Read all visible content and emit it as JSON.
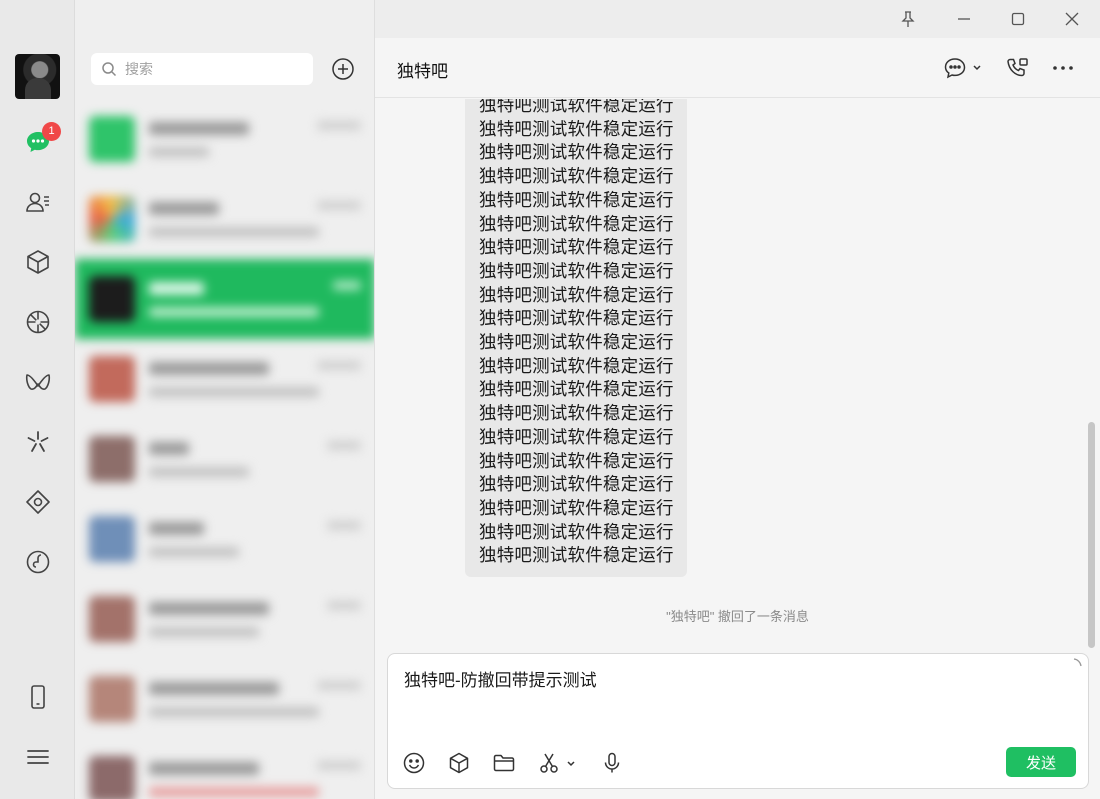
{
  "rail": {
    "unread_badge": "1",
    "icons": [
      "chat-icon",
      "contacts-icon",
      "cube-icon",
      "moments-icon",
      "channels-icon",
      "discover-icon",
      "mini-program-icon",
      "music-icon",
      "phone-icon",
      "menu-icon"
    ]
  },
  "search": {
    "placeholder": "搜索"
  },
  "chat": {
    "title": "独特吧",
    "bubble_lines": [
      "独特吧测试软件稳定运行",
      "独特吧测试软件稳定运行",
      "独特吧测试软件稳定运行",
      "独特吧测试软件稳定运行",
      "独特吧测试软件稳定运行",
      "独特吧测试软件稳定运行",
      "独特吧测试软件稳定运行",
      "独特吧测试软件稳定运行",
      "独特吧测试软件稳定运行",
      "独特吧测试软件稳定运行",
      "独特吧测试软件稳定运行",
      "独特吧测试软件稳定运行",
      "独特吧测试软件稳定运行",
      "独特吧测试软件稳定运行",
      "独特吧测试软件稳定运行",
      "独特吧测试软件稳定运行",
      "独特吧测试软件稳定运行",
      "独特吧测试软件稳定运行",
      "独特吧测试软件稳定运行",
      "独特吧测试软件稳定运行"
    ],
    "recall_notice": "\"独特吧\" 撤回了一条消息"
  },
  "composer": {
    "draft": "独特吧-防撤回带提示测试",
    "send_label": "发送"
  },
  "colors": {
    "accent": "#1fb95e",
    "badge": "#f04848"
  }
}
